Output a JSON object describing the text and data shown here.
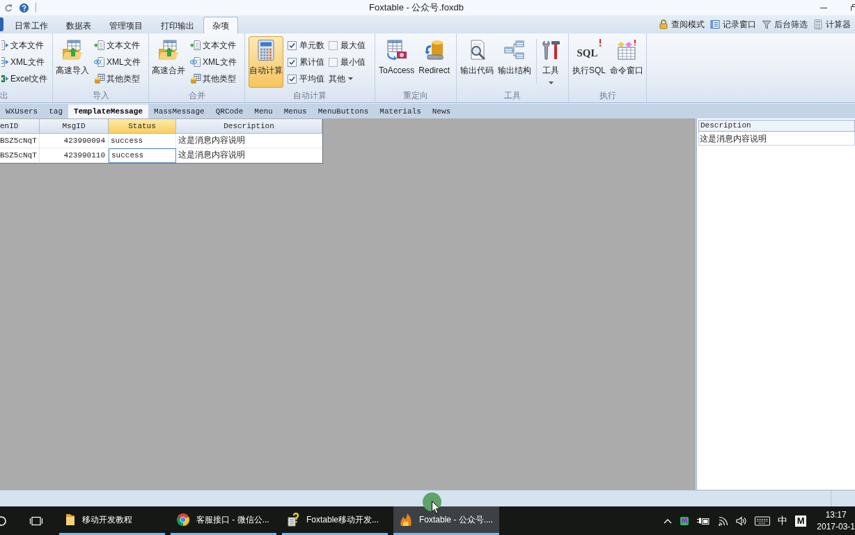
{
  "title_bar": {
    "title": "Foxtable - 公众号.foxdb"
  },
  "ribbon_tabs": [
    {
      "label": "日常工作",
      "selected": false
    },
    {
      "label": "数据表",
      "selected": false
    },
    {
      "label": "管理项目",
      "selected": false
    },
    {
      "label": "打印输出",
      "selected": false
    },
    {
      "label": "杂项",
      "selected": true
    }
  ],
  "quick_tools": [
    {
      "label": "查阅模式"
    },
    {
      "label": "记录窗口"
    },
    {
      "label": "后台筛选"
    },
    {
      "label": "计算器"
    }
  ],
  "ribbon_groups": [
    {
      "label": "出",
      "items": [
        {
          "kind": "small",
          "label": "文本文件"
        },
        {
          "kind": "small",
          "label": "XML文件"
        },
        {
          "kind": "small",
          "label": "Excel文件"
        }
      ]
    },
    {
      "label": "导入",
      "items": [
        {
          "kind": "large",
          "label": "高速导入",
          "on": false
        },
        {
          "kind": "small",
          "label": "文本文件"
        },
        {
          "kind": "small",
          "label": "XML文件"
        },
        {
          "kind": "small",
          "label": "其他类型"
        }
      ]
    },
    {
      "label": "合并",
      "items": [
        {
          "kind": "large",
          "label": "高速合并",
          "on": false
        },
        {
          "kind": "small",
          "label": "文本文件"
        },
        {
          "kind": "small",
          "label": "XML文件"
        },
        {
          "kind": "small",
          "label": "其他类型"
        }
      ]
    },
    {
      "label": "自动计算",
      "items": [
        {
          "kind": "large",
          "label": "自动计算",
          "on": true
        },
        {
          "kind": "checkbox",
          "label": "单元数",
          "checked": true
        },
        {
          "kind": "checkbox",
          "label": "累计值",
          "checked": true
        },
        {
          "kind": "checkbox",
          "label": "平均值",
          "checked": true
        },
        {
          "kind": "checkbox",
          "label": "最大值",
          "checked": false
        },
        {
          "kind": "checkbox",
          "label": "最小值",
          "checked": false
        },
        {
          "kind": "dropdown",
          "label": "其他"
        }
      ]
    },
    {
      "label": "重定向",
      "items": [
        {
          "kind": "large",
          "label": "ToAccess",
          "on": false
        },
        {
          "kind": "large",
          "label": "Redirect",
          "on": false
        }
      ]
    },
    {
      "label": "工具",
      "items": [
        {
          "kind": "large",
          "label": "输出代码",
          "on": false
        },
        {
          "kind": "large",
          "label": "输出结构",
          "on": false
        },
        {
          "kind": "large_menu",
          "label": "工具",
          "on": false
        }
      ]
    },
    {
      "label": "执行",
      "items": [
        {
          "kind": "large",
          "label": "执行SQL",
          "icon_text": "SQL",
          "on": false
        },
        {
          "kind": "large",
          "label": "命令窗口",
          "on": false
        }
      ]
    }
  ],
  "table_tabs": [
    {
      "label": "WXUsers",
      "selected": false
    },
    {
      "label": "tag",
      "selected": false
    },
    {
      "label": "TemplateMessage",
      "selected": true
    },
    {
      "label": "MassMessage",
      "selected": false
    },
    {
      "label": "QRCode",
      "selected": false
    },
    {
      "label": "Menu",
      "selected": false
    },
    {
      "label": "Menus",
      "selected": false
    },
    {
      "label": "MenuButtons",
      "selected": false
    },
    {
      "label": "Materials",
      "selected": false
    },
    {
      "label": "News",
      "selected": false
    }
  ],
  "grid": {
    "columns": [
      {
        "label": "enID",
        "selected": false
      },
      {
        "label": "MsgID",
        "selected": false
      },
      {
        "label": "Status",
        "selected": true
      },
      {
        "label": "Description",
        "selected": false
      }
    ],
    "rows": [
      {
        "cells": [
          {
            "text": "BSZ5cNqT",
            "selected": false
          },
          {
            "text": "423990094",
            "selected": false
          },
          {
            "text": "success",
            "selected": false
          },
          {
            "text": "这是消息内容说明",
            "selected": false
          }
        ]
      },
      {
        "cells": [
          {
            "text": "BSZ5cNqT",
            "selected": false
          },
          {
            "text": "423990110",
            "selected": false
          },
          {
            "text": "success",
            "selected": true
          },
          {
            "text": "这是消息内容说明",
            "selected": false
          }
        ]
      }
    ]
  },
  "detail_panel": {
    "header": "Description",
    "value": "这是消息内容说明"
  },
  "taskbar": {
    "apps": [
      {
        "label": "移动开发教程",
        "selected": false
      },
      {
        "label": "客服接口 - 微信公...",
        "selected": false
      },
      {
        "label": "Foxtable移动开发...",
        "selected": false
      },
      {
        "label": "Foxtable - 公众号....",
        "selected": true
      }
    ],
    "input_method": "中",
    "keyboard_layout": "M",
    "time": "13:17",
    "date": "2017-03-1"
  }
}
